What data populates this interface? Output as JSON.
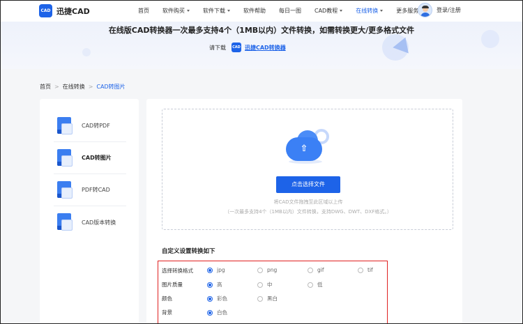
{
  "header": {
    "logo_mark": "CAD",
    "logo_text": "迅捷CAD",
    "menu": [
      {
        "label": "首页",
        "caret": false,
        "active": false
      },
      {
        "label": "软件购买",
        "caret": true,
        "active": false
      },
      {
        "label": "软件下载",
        "caret": true,
        "active": false
      },
      {
        "label": "软件帮助",
        "caret": false,
        "active": false
      },
      {
        "label": "每日一图",
        "caret": false,
        "active": false
      },
      {
        "label": "CAD教程",
        "caret": true,
        "active": false
      },
      {
        "label": "在线转换",
        "caret": true,
        "active": true
      },
      {
        "label": "更多服务",
        "caret": true,
        "active": false
      }
    ],
    "login_label": "登录/注册"
  },
  "banner": {
    "title": "在线版CAD转换器一次最多支持4个（1MB以内）文件转换，如需转换更大/更多格式文件",
    "download_prefix": "请下载",
    "mini_logo": "CAD",
    "download_link": "迅捷CAD转换器"
  },
  "breadcrumb": {
    "items": [
      "首页",
      "在线转换",
      "CAD转图片"
    ],
    "separator": ">"
  },
  "sidebar": {
    "items": [
      {
        "label": "CAD转PDF",
        "active": false
      },
      {
        "label": "CAD转图片",
        "active": true
      },
      {
        "label": "PDF转CAD",
        "active": false
      },
      {
        "label": "CAD版本转换",
        "active": false
      }
    ]
  },
  "upload": {
    "button_label": "点击选择文件",
    "hint_line1": "将CAD文件拖拽至此区域以上传",
    "hint_line2": "（一次最多支持4个（1MB以内）文件转换，支持DWG、DWT、DXF格式。）",
    "arrow_glyph": "⇧"
  },
  "settings": {
    "title": "自定义设置转换如下",
    "rows": [
      {
        "label": "选择转换格式",
        "options": [
          "jpg",
          "png",
          "gif",
          "tif"
        ],
        "selected": "jpg"
      },
      {
        "label": "图片质量",
        "options": [
          "高",
          "中",
          "低"
        ],
        "selected": "高"
      },
      {
        "label": "颜色",
        "options": [
          "彩色",
          "黑白"
        ],
        "selected": "彩色"
      },
      {
        "label": "背景",
        "options": [
          "白色"
        ],
        "selected": "白色"
      }
    ]
  },
  "colors": {
    "accent": "#1d63e8",
    "highlight_border": "#e02020"
  }
}
